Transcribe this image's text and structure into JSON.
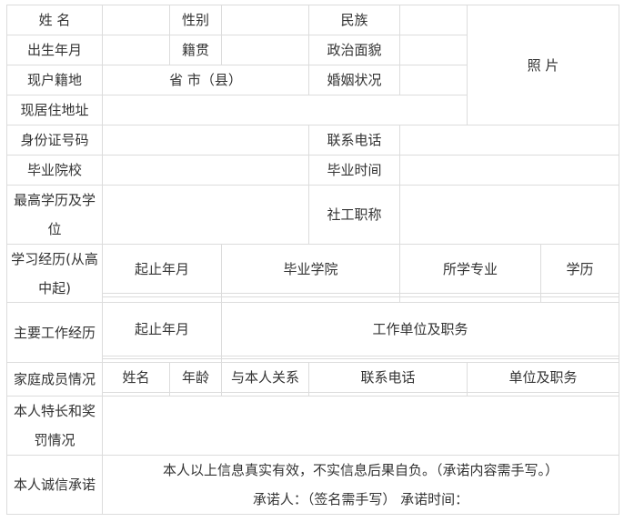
{
  "form": {
    "name_label": "姓 名",
    "gender_label": "性别",
    "ethnicity_label": "民族",
    "photo_label": "照 片",
    "birth_label": "出生年月",
    "native_place_label": "籍贯",
    "political_label": "政治面貌",
    "household_label": "现户籍地",
    "household_value": "省 市（县）",
    "marital_label": "婚姻状况",
    "address_label": "现居住地址",
    "id_label": "身份证号码",
    "phone_label": "联系电话",
    "school_label": "毕业院校",
    "grad_time_label": "毕业时间",
    "degree_label": "最高学历及学位",
    "title_label": "社工职称",
    "study_label": "学习经历(从高中起)",
    "study_cols": [
      "起止年月",
      "毕业学院",
      "所学专业",
      "学历"
    ],
    "work_label": "主要工作经历",
    "work_cols": [
      "起止年月",
      "工作单位及职务"
    ],
    "family_label": "家庭成员情况",
    "family_cols": [
      "姓名",
      "年龄",
      "与本人关系",
      "联系电话",
      "单位及职务"
    ],
    "skills_label": "本人特长和奖罚情况",
    "promise_label": "本人诚信承诺",
    "promise_text": "本人以上信息真实有效，不实信息后果自负。（承诺内容需手写。）",
    "promise_sign": "承诺人：（签名需手写） 承诺时间："
  }
}
